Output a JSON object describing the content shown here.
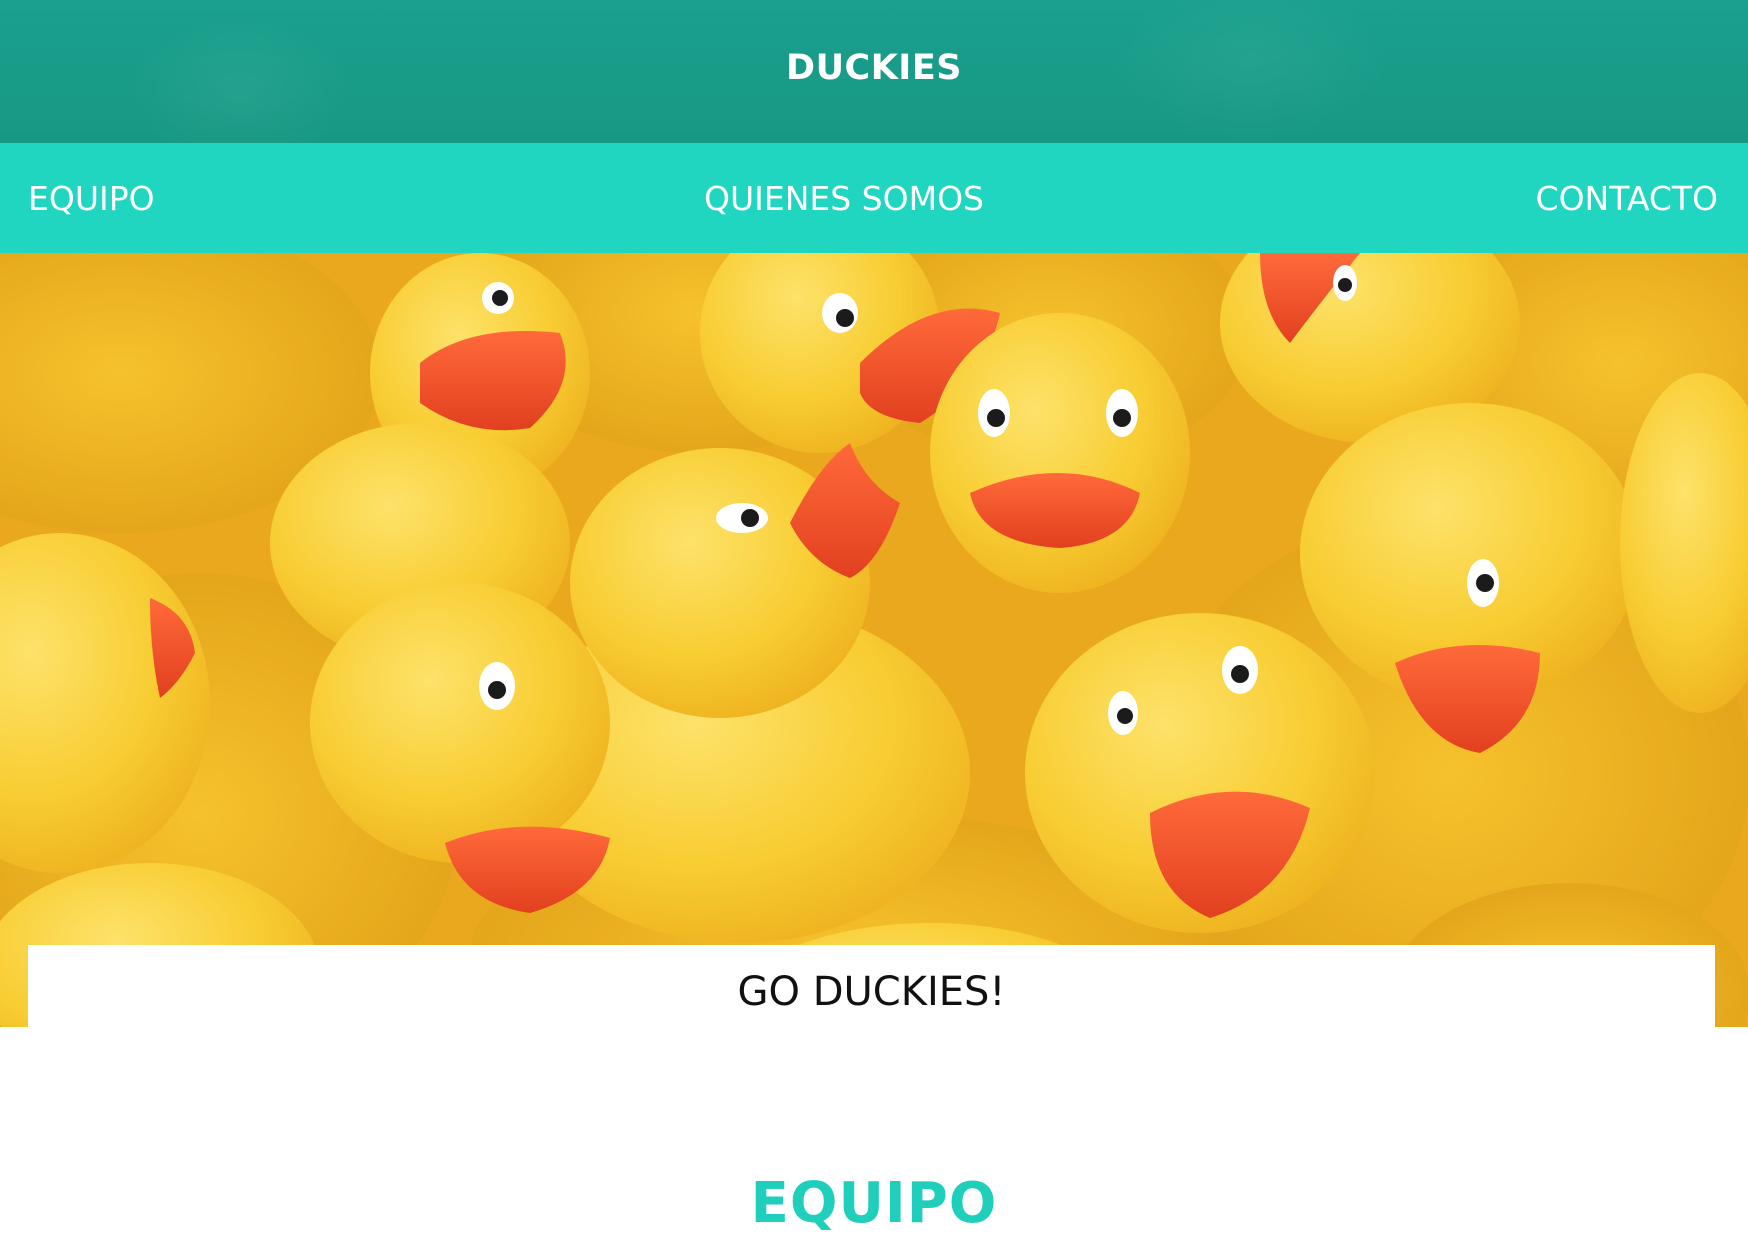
{
  "header": {
    "site_title": "DUCKIES"
  },
  "nav": {
    "items": [
      {
        "label": "EQUIPO"
      },
      {
        "label": "QUIENES SOMOS"
      },
      {
        "label": "CONTACTO"
      }
    ]
  },
  "hero": {
    "image_alt": "rubber ducks",
    "caption": "GO DUCKIES!"
  },
  "section": {
    "heading": "EQUIPO"
  },
  "colors": {
    "header_bg": "#179884",
    "nav_bg": "#20d6c0",
    "heading_accent": "#1fcfbc",
    "duck_yellow": "#f8cd33",
    "beak_orange": "#f2502a"
  }
}
